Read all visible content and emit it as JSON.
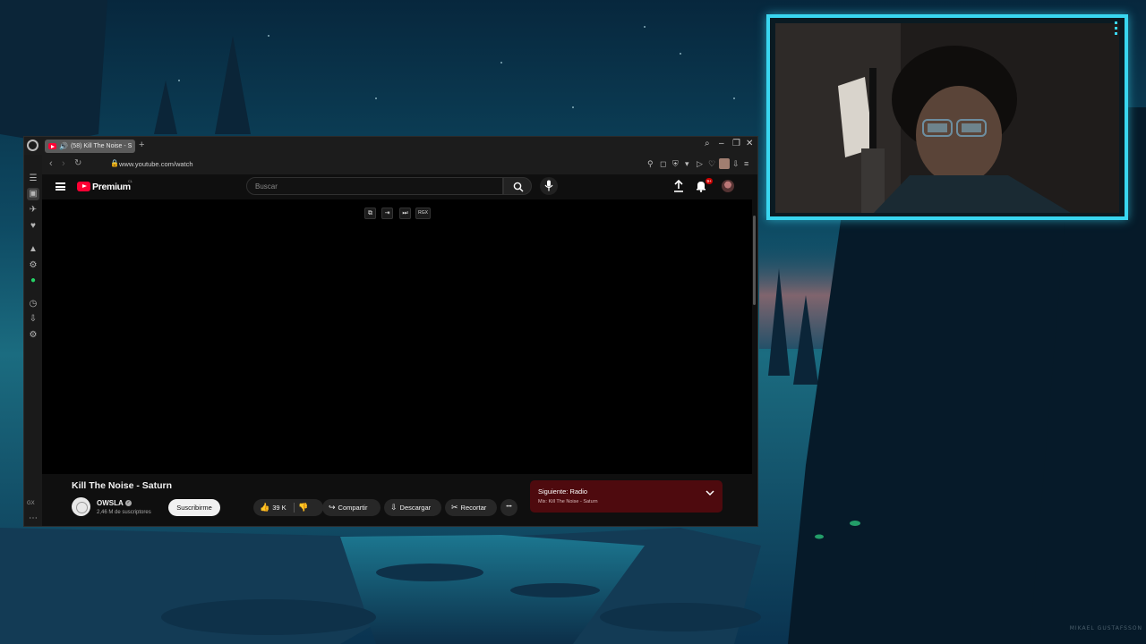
{
  "wallpaper": {
    "watermark": "MIKAEL GUSTAFSSON"
  },
  "browser": {
    "tab_title": "(58) Kill The Noise - S",
    "url": "www.youtube.com/watch",
    "sidebar_label": "GX"
  },
  "youtube": {
    "brand": "Premium",
    "region": "CL",
    "search_placeholder": "Buscar",
    "notifications_badge": "9+",
    "player_controls": [
      "⧉",
      "⇥",
      "⏭",
      "RGX"
    ],
    "video_title": "Kill The Noise - Saturn",
    "channel": {
      "name": "OWSLA",
      "subscribers": "2,46 M de suscriptores"
    },
    "subscribe_label": "Suscribirme",
    "actions": {
      "likes": "39 K",
      "share": "Compartir",
      "download": "Descargar",
      "clip": "Recortar",
      "more": "•••"
    },
    "up_next": {
      "title": "Siguiente: Radio",
      "subtitle": "Mix: Kill The Noise - Saturn"
    }
  },
  "colors": {
    "accent": "#39d6f0",
    "yt_red": "#ff0033",
    "up_next_bg": "#4e0a0e"
  }
}
